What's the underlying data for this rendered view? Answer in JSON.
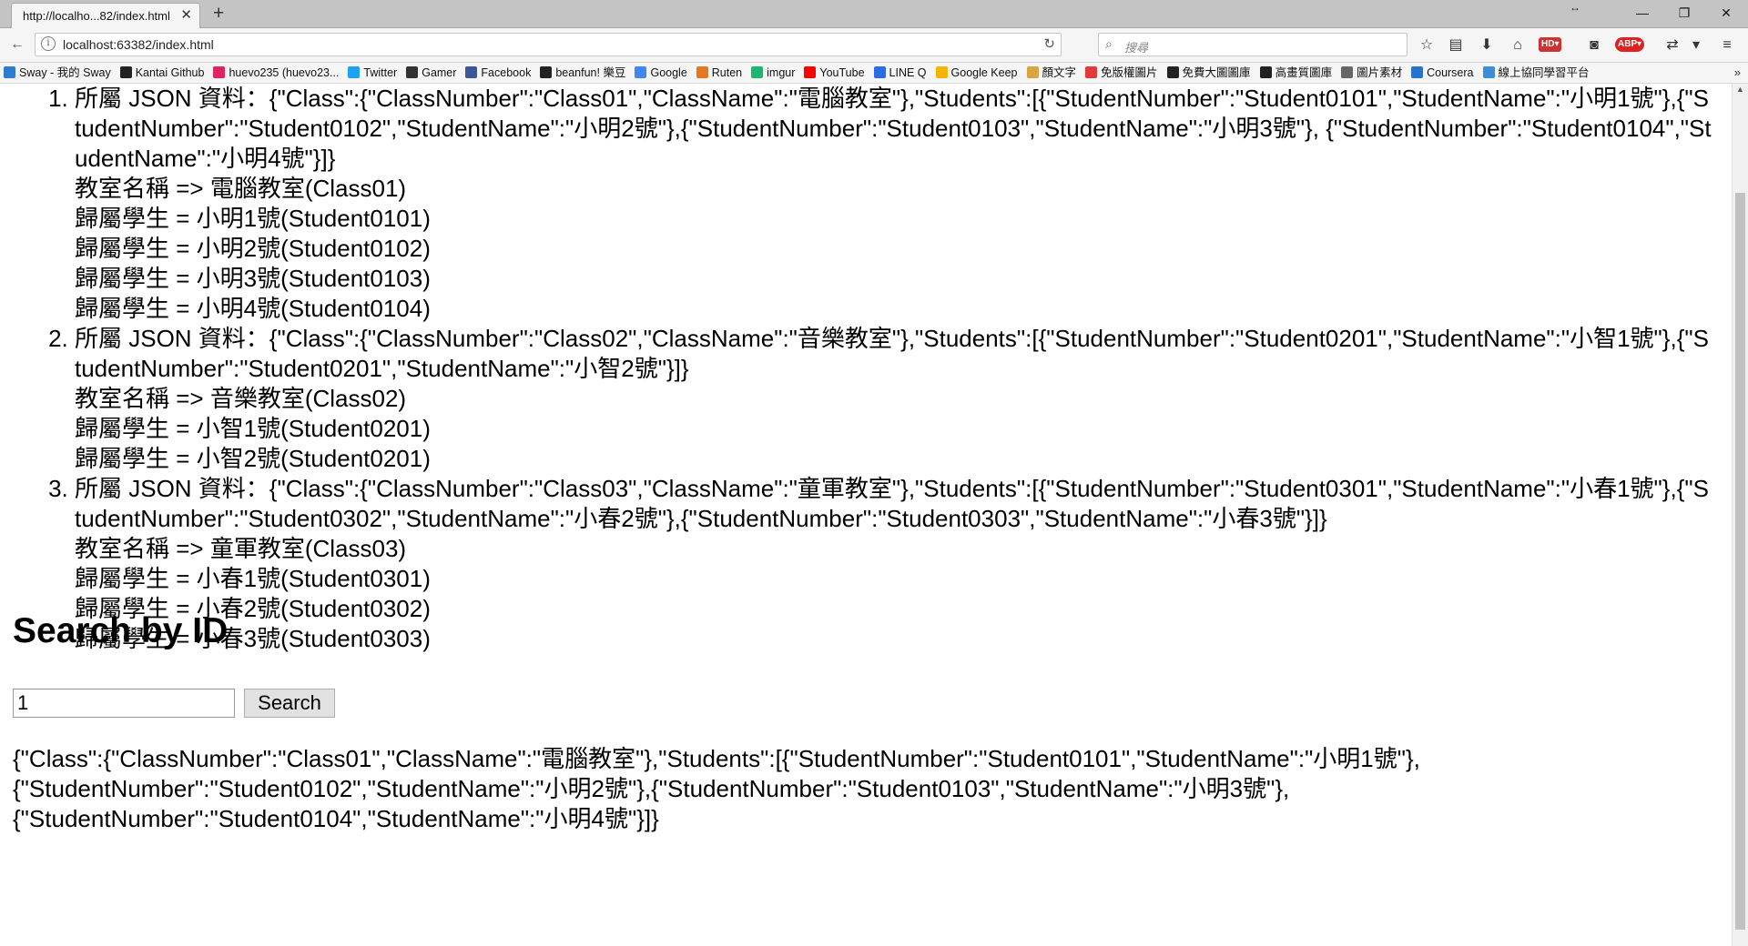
{
  "tab": {
    "title": "http://localho...82/index.html",
    "close": "✕",
    "new_tab": "+"
  },
  "window": {
    "minimize": "—",
    "maximize": "❐",
    "close": "✕",
    "resize": "↔"
  },
  "nav": {
    "url": "localhost:63382/index.html",
    "search_placeholder": "搜尋"
  },
  "bookmarks": [
    {
      "label": "Sway - 我的 Sway",
      "icon": "windows-icon",
      "color": "#2e7bcf"
    },
    {
      "label": "Kantai Github",
      "icon": "github-icon",
      "color": "#222222"
    },
    {
      "label": "huevo235 (huevo23...",
      "icon": "pixiv-icon",
      "color": "#e0245e"
    },
    {
      "label": "Twitter",
      "icon": "twitter-icon",
      "color": "#1da1f2"
    },
    {
      "label": "Gamer",
      "icon": "gamer-icon",
      "color": "#333333"
    },
    {
      "label": "Facebook",
      "icon": "facebook-icon",
      "color": "#3b5998"
    },
    {
      "label": "beanfun! 樂豆",
      "icon": "beanfun-icon",
      "color": "#222222"
    },
    {
      "label": "Google",
      "icon": "google-icon",
      "color": "#4285f4"
    },
    {
      "label": "Ruten",
      "icon": "ruten-icon",
      "color": "#e87722"
    },
    {
      "label": "imgur",
      "icon": "imgur-icon",
      "color": "#1bb76e"
    },
    {
      "label": "YouTube",
      "icon": "youtube-icon",
      "color": "#ff0000"
    },
    {
      "label": "LINE Q",
      "icon": "lineq-icon",
      "color": "#2d6be4"
    },
    {
      "label": "Google Keep",
      "icon": "keep-icon",
      "color": "#f6b400"
    },
    {
      "label": "顏文字",
      "icon": "kaomoji-icon",
      "color": "#d9a441"
    },
    {
      "label": "免版權圖片",
      "icon": "free-images-icon",
      "color": "#e03a3a"
    },
    {
      "label": "免費大圖圖庫",
      "icon": "camera-icon",
      "color": "#222222"
    },
    {
      "label": "高畫質圖庫",
      "icon": "bolt-icon",
      "color": "#222222"
    },
    {
      "label": "圖片素材",
      "icon": "globe-icon",
      "color": "#666666"
    },
    {
      "label": "Coursera",
      "icon": "coursera-icon",
      "color": "#2a73cc"
    },
    {
      "label": "線上協同學習平台",
      "icon": "collab-icon",
      "color": "#3a8fd6"
    }
  ],
  "page": {
    "classes": [
      {
        "json_line": "所屬 JSON 資料：{\"Class\":{\"ClassNumber\":\"Class01\",\"ClassName\":\"電腦教室\"},\"Students\":[{\"StudentNumber\":\"Student0101\",\"StudentName\":\"小明1號\"},{\"StudentNumber\":\"Student0102\",\"StudentName\":\"小明2號\"},{\"StudentNumber\":\"Student0103\",\"StudentName\":\"小明3號\"}, {\"StudentNumber\":\"Student0104\",\"StudentName\":\"小明4號\"}]}",
        "room": "教室名稱 => 電腦教室(Class01)",
        "students": [
          "歸屬學生 = 小明1號(Student0101)",
          "歸屬學生 = 小明2號(Student0102)",
          "歸屬學生 = 小明3號(Student0103)",
          "歸屬學生 = 小明4號(Student0104)"
        ]
      },
      {
        "json_line": "所屬 JSON 資料：{\"Class\":{\"ClassNumber\":\"Class02\",\"ClassName\":\"音樂教室\"},\"Students\":[{\"StudentNumber\":\"Student0201\",\"StudentName\":\"小智1號\"},{\"StudentNumber\":\"Student0201\",\"StudentName\":\"小智2號\"}]}",
        "room": "教室名稱 => 音樂教室(Class02)",
        "students": [
          "歸屬學生 = 小智1號(Student0201)",
          "歸屬學生 = 小智2號(Student0201)"
        ]
      },
      {
        "json_line": "所屬 JSON 資料：{\"Class\":{\"ClassNumber\":\"Class03\",\"ClassName\":\"童軍教室\"},\"Students\":[{\"StudentNumber\":\"Student0301\",\"StudentName\":\"小春1號\"},{\"StudentNumber\":\"Student0302\",\"StudentName\":\"小春2號\"},{\"StudentNumber\":\"Student0303\",\"StudentName\":\"小春3號\"}]}",
        "room": "教室名稱 => 童軍教室(Class03)",
        "students": [
          "歸屬學生 = 小春1號(Student0301)",
          "歸屬學生 = 小春2號(Student0302)",
          "歸屬學生 = 小春3號(Student0303)"
        ]
      }
    ],
    "search_title": "Search by ID",
    "search_value": "1",
    "search_button": "Search",
    "result_text": "{\"Class\":{\"ClassNumber\":\"Class01\",\"ClassName\":\"電腦教室\"},\"Students\":[{\"StudentNumber\":\"Student0101\",\"StudentName\":\"小明1號\"}, {\"StudentNumber\":\"Student0102\",\"StudentName\":\"小明2號\"},{\"StudentNumber\":\"Student0103\",\"StudentName\":\"小明3號\"}, {\"StudentNumber\":\"Student0104\",\"StudentName\":\"小明4號\"}]}"
  }
}
